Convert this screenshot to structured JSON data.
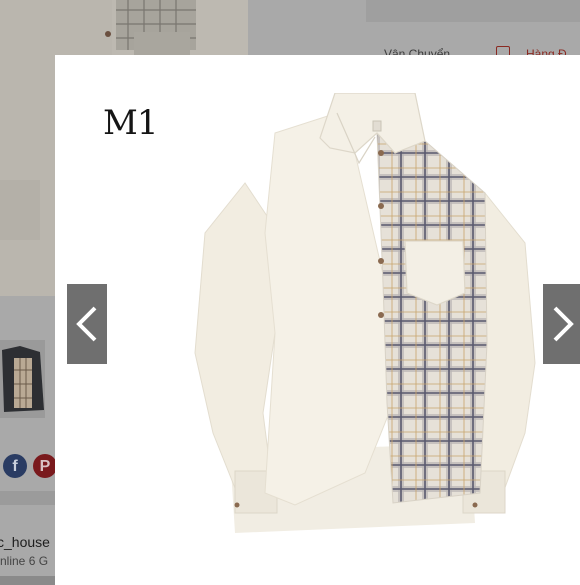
{
  "background_page": {
    "shipping_label": "Vận Chuyển",
    "partial_red_label": "Hàng Đ",
    "shop_name": "c_house",
    "shop_status": "nline 6 G"
  },
  "modal": {
    "logo_text": "M1",
    "nav": {
      "prev_icon": "chevron-left-icon",
      "next_icon": "chevron-right-icon"
    }
  },
  "colors": {
    "overlay": "#8a8a8a",
    "nav_button": "#6f6f6f",
    "shirt_cream": "#f3eee3",
    "plaid_base": "#e6e1d8",
    "plaid_line": "#59596e"
  }
}
